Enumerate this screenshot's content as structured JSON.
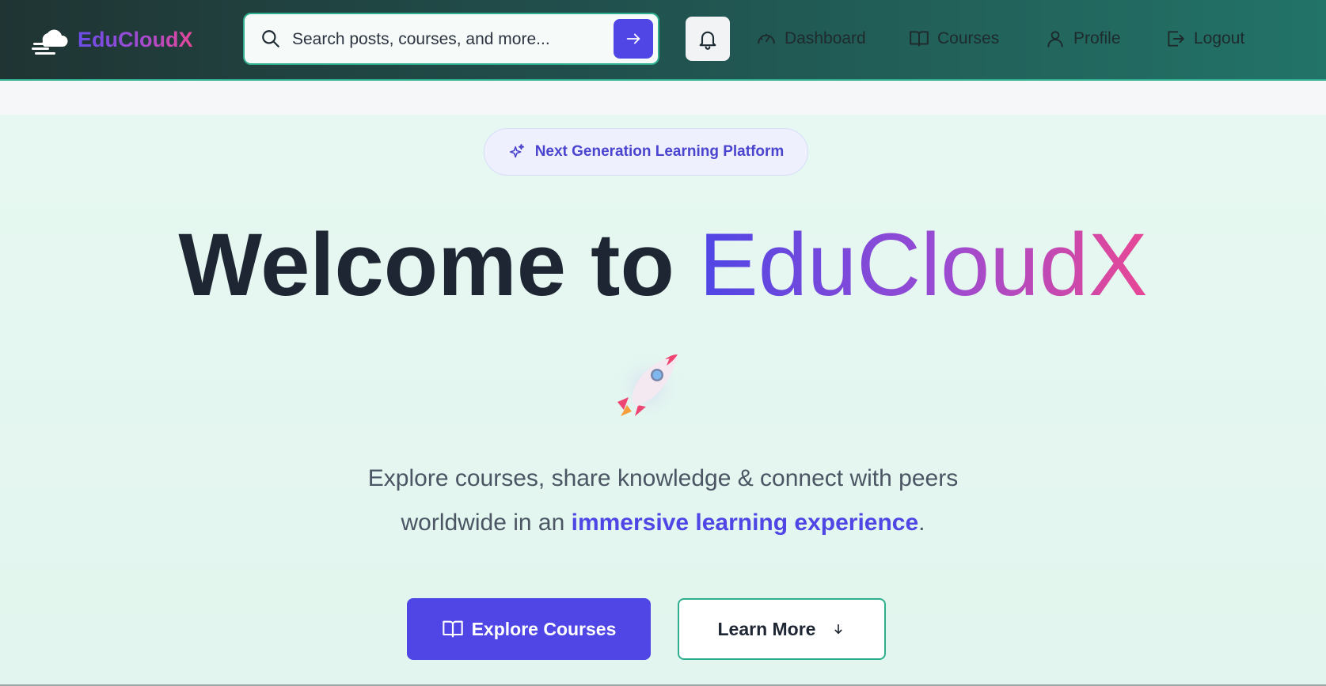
{
  "brand": {
    "name": "EduCloudX"
  },
  "search": {
    "placeholder": "Search posts, courses, and more..."
  },
  "nav": {
    "items": [
      {
        "label": "Dashboard",
        "icon": "gauge-icon"
      },
      {
        "label": "Courses",
        "icon": "book-icon"
      },
      {
        "label": "Profile",
        "icon": "user-icon"
      },
      {
        "label": "Logout",
        "icon": "logout-icon"
      }
    ]
  },
  "hero": {
    "badge": "Next Generation Learning Platform",
    "title_prefix": "Welcome to",
    "title_brand": "EduCloudX",
    "subtitle_line1": "Explore courses, share knowledge & connect with peers",
    "subtitle_line2_start": "worldwide in an",
    "subtitle_highlight": "immersive learning experience",
    "subtitle_end": ".",
    "primary_button": "Explore Courses",
    "secondary_button": "Learn More"
  },
  "colors": {
    "accent": "#4f46e5",
    "teal": "#2fae8e",
    "brand_gradient_start": "#4f46e5",
    "brand_gradient_end": "#e84795"
  }
}
